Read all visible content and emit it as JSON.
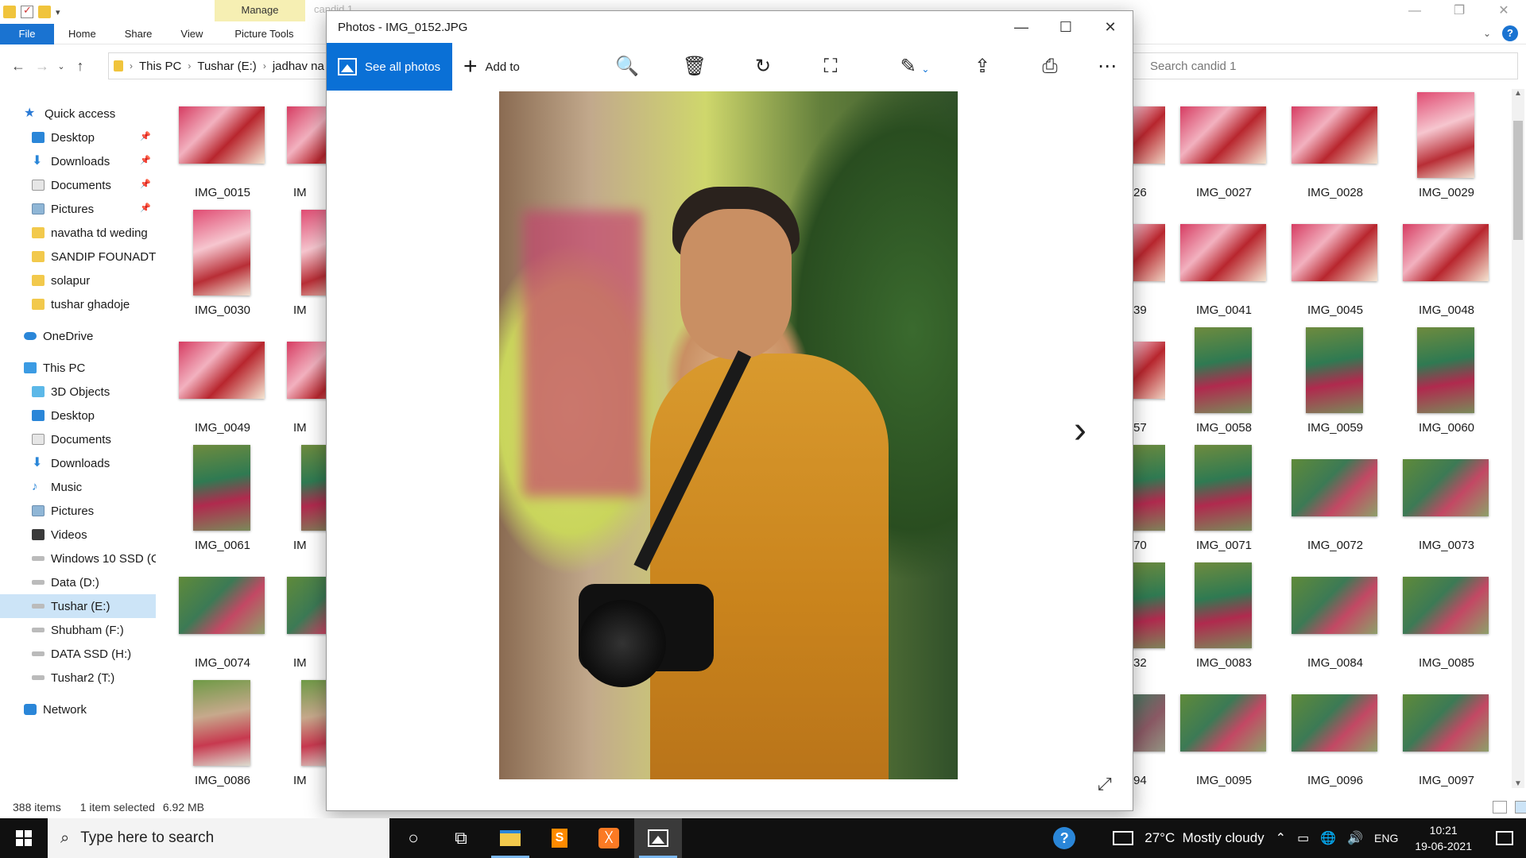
{
  "explorer": {
    "ribbon": {
      "manage_tab": "Manage",
      "ghost_title": "candid 1",
      "file_tab": "File",
      "tabs": [
        "Home",
        "Share",
        "View",
        "Picture Tools"
      ]
    },
    "address": {
      "crumbs": [
        "This PC",
        "Tushar (E:)",
        "jadhav na"
      ]
    },
    "search_placeholder": "Search candid 1",
    "nav": {
      "quick_access": "Quick access",
      "quick_items": [
        {
          "label": "Desktop",
          "icon": "desktop-icon"
        },
        {
          "label": "Downloads",
          "icon": "downloads-icon"
        },
        {
          "label": "Documents",
          "icon": "documents-icon"
        },
        {
          "label": "Pictures",
          "icon": "pictures-icon"
        },
        {
          "label": "navatha td weding",
          "icon": "folder-icon"
        },
        {
          "label": "SANDIP FOUNADTI(",
          "icon": "folder-icon"
        },
        {
          "label": "solapur",
          "icon": "folder-icon"
        },
        {
          "label": "tushar ghadoje",
          "icon": "folder-icon"
        }
      ],
      "onedrive": "OneDrive",
      "this_pc": "This PC",
      "pc_items": [
        "3D Objects",
        "Desktop",
        "Documents",
        "Downloads",
        "Music",
        "Pictures",
        "Videos",
        "Windows 10 SSD (C",
        "Data (D:)",
        "Tushar (E:)",
        "Shubham (F:)",
        "DATA SSD (H:)",
        "Tushar2 (T:)"
      ],
      "network": "Network"
    },
    "files": {
      "left_col": [
        "IMG_0015",
        "IMG_0030",
        "IMG_0049",
        "IMG_0061",
        "IMG_0074",
        "IMG_0086"
      ],
      "partial_left": [
        "IM",
        "IM",
        "IM",
        "IM",
        "IM",
        "IM"
      ],
      "partial_right": [
        "26",
        "39",
        "57",
        "70",
        "32",
        "94"
      ],
      "right_cols": [
        [
          "IMG_0027",
          "IMG_0028",
          "IMG_0029"
        ],
        [
          "IMG_0041",
          "IMG_0045",
          "IMG_0048"
        ],
        [
          "IMG_0058",
          "IMG_0059",
          "IMG_0060"
        ],
        [
          "IMG_0071",
          "IMG_0072",
          "IMG_0073"
        ],
        [
          "IMG_0083",
          "IMG_0084",
          "IMG_0085"
        ],
        [
          "IMG_0095",
          "IMG_0096",
          "IMG_0097"
        ]
      ]
    },
    "status": {
      "count": "388 items",
      "selection": "1 item selected",
      "size": "6.92 MB"
    }
  },
  "photos": {
    "title": "Photos - IMG_0152.JPG",
    "see_all": "See all photos",
    "add_to": "Add to",
    "accent": "#0a70d6"
  },
  "taskbar": {
    "search_placeholder": "Type here to search",
    "weather": "27°C  Mostly cloudy",
    "lang": "ENG",
    "time": "10:21",
    "date": "19-06-2021"
  }
}
